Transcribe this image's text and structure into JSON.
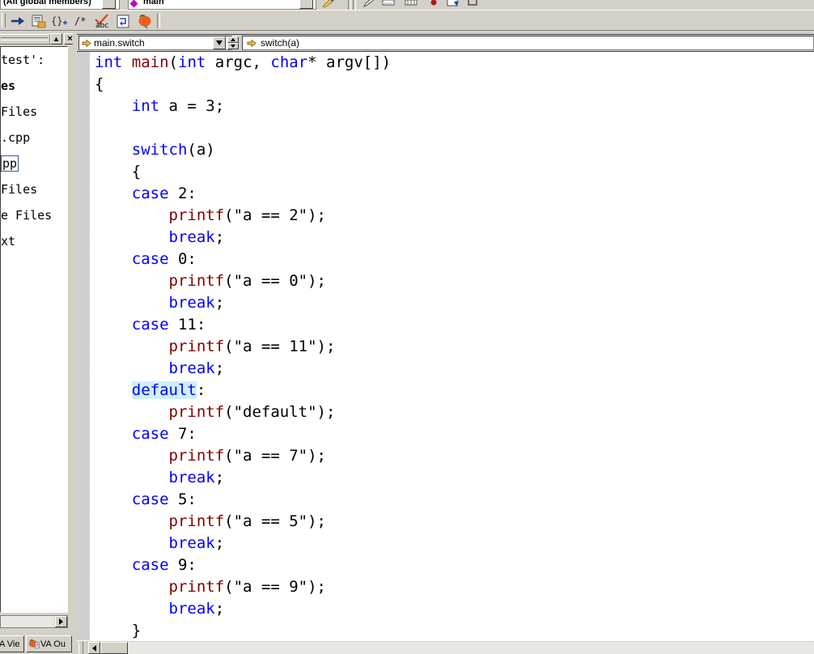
{
  "window": {
    "app": "visual-studio-editor",
    "background_color": "#d4d0c8"
  },
  "top_strip": {
    "member_combo_value": "(All global members)",
    "symbol_combo_value": "main",
    "icons": [
      {
        "name": "wand-icon"
      },
      {
        "name": "grip-icon"
      },
      {
        "name": "pencil-icon"
      },
      {
        "name": "ruler-icon"
      },
      {
        "name": "grid-icon"
      },
      {
        "name": "red-dot-icon"
      },
      {
        "name": "window-blue-icon"
      },
      {
        "name": "bracket-icon"
      }
    ]
  },
  "toolbar": {
    "buttons": [
      {
        "name": "goto-arrow-icon",
        "glyph": "⇒",
        "color": "#183c8c"
      },
      {
        "name": "open-file-icon",
        "glyph": "",
        "color": "#b0721f"
      },
      {
        "name": "insert-snippet-icon",
        "glyph": "{}",
        "color": "#404040"
      },
      {
        "name": "comment-icon",
        "glyph": "/*",
        "color": "#000000"
      },
      {
        "name": "spellcheck-abc-icon",
        "glyph": "abc",
        "color": "#000000"
      },
      {
        "name": "refactor-icon",
        "glyph": "",
        "color": "#2050b0"
      },
      {
        "name": "tomato-icon",
        "glyph": "",
        "color": "#e8601c"
      }
    ]
  },
  "left_panel": {
    "title": "solution-explorer",
    "close_button": "×",
    "scroll_up_button": "▲",
    "scroll_right_button": "▶",
    "tree_items": [
      {
        "label": " test':",
        "bold": false,
        "selected": false
      },
      {
        "label": "es",
        "bold": true,
        "selected": false
      },
      {
        "label": "Files",
        "bold": false,
        "selected": false
      },
      {
        "label": ".cpp",
        "bold": false,
        "selected": false
      },
      {
        "label": "pp",
        "bold": false,
        "selected": true
      },
      {
        "label": "Files",
        "bold": false,
        "selected": false
      },
      {
        "label": "e Files",
        "bold": false,
        "selected": false
      },
      {
        "label": "xt",
        "bold": false,
        "selected": false
      }
    ],
    "tabs": [
      {
        "name": "va-view-tab",
        "label": "A Vie",
        "icon": ""
      },
      {
        "name": "va-outline-tab",
        "label": "VA Ou",
        "icon": "tomato-icon"
      }
    ]
  },
  "editor": {
    "nav_left_combo": {
      "value": "main.switch",
      "icon": "yellow-arrow-icon",
      "dropdown_glyph": "▼"
    },
    "nav_right_combo": {
      "value": "switch(a)",
      "icon": "yellow-arrow-icon"
    },
    "spinner": {
      "up": "▲",
      "down": "▼"
    },
    "highlighted_token": "default",
    "highlight_color": "#cfeffb",
    "colors": {
      "keyword": "#0000ff",
      "function": "#800000",
      "plain": "#000000",
      "background": "#ffffff"
    },
    "code_lines": [
      [
        {
          "t": "int",
          "c": "kw"
        },
        {
          "t": " ",
          "c": "pl"
        },
        {
          "t": "main",
          "c": "fn"
        },
        {
          "t": "(",
          "c": "pl"
        },
        {
          "t": "int",
          "c": "kw"
        },
        {
          "t": " argc, ",
          "c": "pl"
        },
        {
          "t": "char",
          "c": "kw"
        },
        {
          "t": "* argv[])",
          "c": "pl"
        }
      ],
      [
        {
          "t": "{",
          "c": "pl"
        }
      ],
      [
        {
          "t": "    ",
          "c": "pl"
        },
        {
          "t": "int",
          "c": "kw"
        },
        {
          "t": " a = 3;",
          "c": "pl"
        }
      ],
      [],
      [
        {
          "t": "    ",
          "c": "pl"
        },
        {
          "t": "switch",
          "c": "kw"
        },
        {
          "t": "(a)",
          "c": "pl"
        }
      ],
      [
        {
          "t": "    {",
          "c": "pl"
        }
      ],
      [
        {
          "t": "    ",
          "c": "pl"
        },
        {
          "t": "case",
          "c": "kw"
        },
        {
          "t": " 2:",
          "c": "pl"
        }
      ],
      [
        {
          "t": "        ",
          "c": "pl"
        },
        {
          "t": "printf",
          "c": "fn"
        },
        {
          "t": "(\"a == 2\");",
          "c": "pl"
        }
      ],
      [
        {
          "t": "        ",
          "c": "pl"
        },
        {
          "t": "break",
          "c": "kw"
        },
        {
          "t": ";",
          "c": "pl"
        }
      ],
      [
        {
          "t": "    ",
          "c": "pl"
        },
        {
          "t": "case",
          "c": "kw"
        },
        {
          "t": " 0:",
          "c": "pl"
        }
      ],
      [
        {
          "t": "        ",
          "c": "pl"
        },
        {
          "t": "printf",
          "c": "fn"
        },
        {
          "t": "(\"a == 0\");",
          "c": "pl"
        }
      ],
      [
        {
          "t": "        ",
          "c": "pl"
        },
        {
          "t": "break",
          "c": "kw"
        },
        {
          "t": ";",
          "c": "pl"
        }
      ],
      [
        {
          "t": "    ",
          "c": "pl"
        },
        {
          "t": "case",
          "c": "kw"
        },
        {
          "t": " 11:",
          "c": "pl"
        }
      ],
      [
        {
          "t": "        ",
          "c": "pl"
        },
        {
          "t": "printf",
          "c": "fn"
        },
        {
          "t": "(\"a == 11\");",
          "c": "pl"
        }
      ],
      [
        {
          "t": "        ",
          "c": "pl"
        },
        {
          "t": "break",
          "c": "kw"
        },
        {
          "t": ";",
          "c": "pl"
        }
      ],
      [
        {
          "t": "    ",
          "c": "pl"
        },
        {
          "t": "default",
          "c": "kw hl"
        },
        {
          "t": ":",
          "c": "pl"
        }
      ],
      [
        {
          "t": "        ",
          "c": "pl"
        },
        {
          "t": "printf",
          "c": "fn"
        },
        {
          "t": "(\"default\");",
          "c": "pl"
        }
      ],
      [
        {
          "t": "    ",
          "c": "pl"
        },
        {
          "t": "case",
          "c": "kw"
        },
        {
          "t": " 7:",
          "c": "pl"
        }
      ],
      [
        {
          "t": "        ",
          "c": "pl"
        },
        {
          "t": "printf",
          "c": "fn"
        },
        {
          "t": "(\"a == 7\");",
          "c": "pl"
        }
      ],
      [
        {
          "t": "        ",
          "c": "pl"
        },
        {
          "t": "break",
          "c": "kw"
        },
        {
          "t": ";",
          "c": "pl"
        }
      ],
      [
        {
          "t": "    ",
          "c": "pl"
        },
        {
          "t": "case",
          "c": "kw"
        },
        {
          "t": " 5:",
          "c": "pl"
        }
      ],
      [
        {
          "t": "        ",
          "c": "pl"
        },
        {
          "t": "printf",
          "c": "fn"
        },
        {
          "t": "(\"a == 5\");",
          "c": "pl"
        }
      ],
      [
        {
          "t": "        ",
          "c": "pl"
        },
        {
          "t": "break",
          "c": "kw"
        },
        {
          "t": ";",
          "c": "pl"
        }
      ],
      [
        {
          "t": "    ",
          "c": "pl"
        },
        {
          "t": "case",
          "c": "kw"
        },
        {
          "t": " 9:",
          "c": "pl"
        }
      ],
      [
        {
          "t": "        ",
          "c": "pl"
        },
        {
          "t": "printf",
          "c": "fn"
        },
        {
          "t": "(\"a == 9\");",
          "c": "pl"
        }
      ],
      [
        {
          "t": "        ",
          "c": "pl"
        },
        {
          "t": "break",
          "c": "kw"
        },
        {
          "t": ";",
          "c": "pl"
        }
      ],
      [
        {
          "t": "    }",
          "c": "pl"
        }
      ]
    ],
    "hscrollbar": {
      "left_arrow": "◀"
    }
  }
}
